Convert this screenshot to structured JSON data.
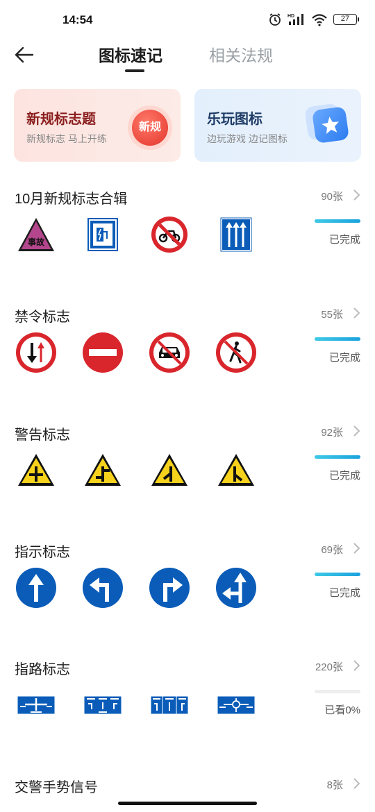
{
  "status": {
    "time": "14:54",
    "battery": "27",
    "hd_label": "HD"
  },
  "nav": {
    "tabs": [
      {
        "label": "图标速记"
      },
      {
        "label": "相关法规"
      }
    ]
  },
  "banners": [
    {
      "title": "新规标志题",
      "subtitle": "新规标志 马上开练",
      "badge": "新规"
    },
    {
      "title": "乐玩图标",
      "subtitle": "边玩游戏 边记图标"
    }
  ],
  "sections": [
    {
      "title": "10月新规标志合辑",
      "count": "90张",
      "status": "已完成",
      "progress": 1.0,
      "signs": [
        "accident-sign",
        "charging-station-sign",
        "no-motorcycles-sign",
        "straight-lanes-sign"
      ],
      "accident_text": "事故"
    },
    {
      "title": "禁令标志",
      "count": "55张",
      "status": "已完成",
      "progress": 1.0,
      "signs": [
        "give-way-oncoming-sign",
        "no-entry-sign",
        "no-cars-sign",
        "no-pedestrians-sign"
      ]
    },
    {
      "title": "警告标志",
      "count": "92张",
      "status": "已完成",
      "progress": 1.0,
      "signs": [
        "crossroad-warning-sign",
        "staggered-junction-warning-sign",
        "side-road-warning-sign",
        "side-road-right-warning-sign"
      ]
    },
    {
      "title": "指示标志",
      "count": "69张",
      "status": "已完成",
      "progress": 1.0,
      "signs": [
        "straight-ahead-sign",
        "turn-left-sign",
        "turn-right-sign",
        "straight-or-left-sign"
      ]
    },
    {
      "title": "指路标志",
      "count": "220张",
      "status": "已看0%",
      "progress": 0.0,
      "signs": [
        "direction-sign-1",
        "direction-sign-2",
        "direction-sign-3",
        "direction-sign-4"
      ]
    },
    {
      "title": "交警手势信号",
      "count": "8张"
    }
  ],
  "colors": {
    "accent_blue": "#1aa2dd",
    "sign_red": "#d9262c",
    "sign_blue": "#0a5cb8",
    "sign_yellow": "#f6d21c"
  }
}
